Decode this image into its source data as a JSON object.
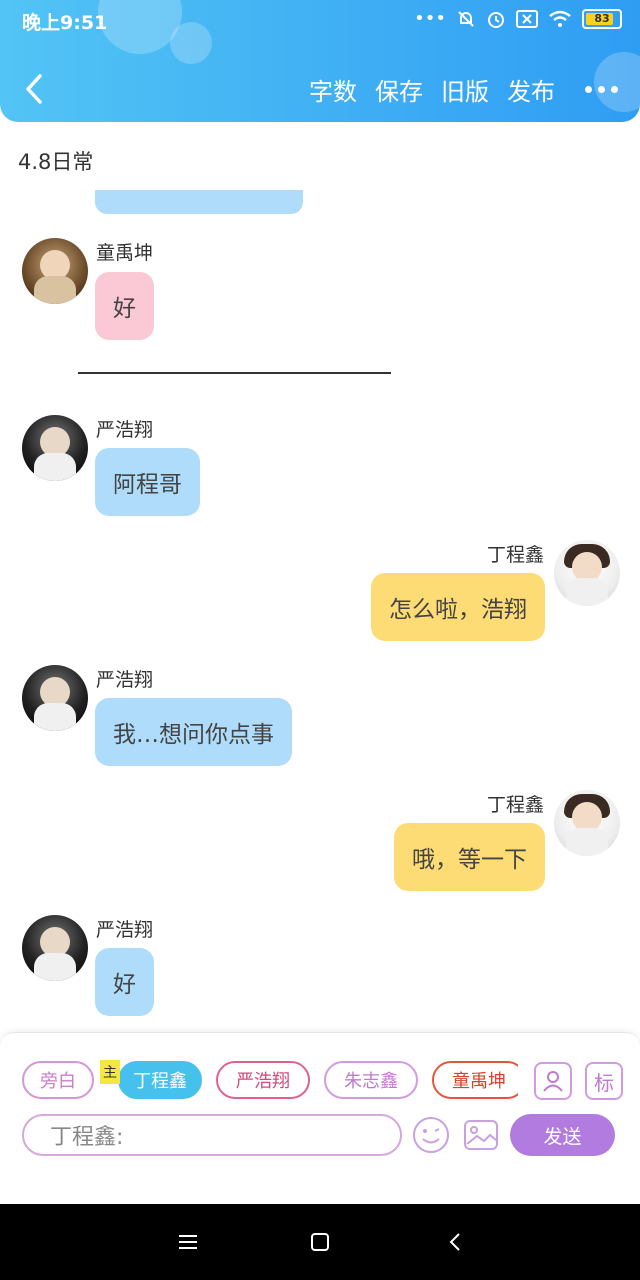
{
  "status_bar": {
    "time": "晚上9:51",
    "battery_level": 83,
    "battery_text": "83",
    "icons": [
      "more-dots-icon",
      "bell-muted-icon",
      "alarm-icon",
      "sim-blocked-icon",
      "wifi-icon",
      "battery-icon"
    ]
  },
  "header": {
    "actions": {
      "word_count": "字数",
      "save": "保存",
      "old_version": "旧版",
      "publish": "发布"
    },
    "accent_color": "#2f9df3"
  },
  "doc_title": "4.8日常",
  "messages": [
    {
      "id": "m1",
      "side": "left",
      "name": "童禹坤",
      "text": "好",
      "color": "pink"
    },
    {
      "id": "m2",
      "side": "left",
      "name": "严浩翔",
      "text": "阿程哥",
      "color": "blue"
    },
    {
      "id": "m3",
      "side": "right",
      "name": "丁程鑫",
      "text": "怎么啦，浩翔",
      "color": "yellow"
    },
    {
      "id": "m4",
      "side": "left",
      "name": "严浩翔",
      "text": "我…想问你点事",
      "color": "blue"
    },
    {
      "id": "m5",
      "side": "right",
      "name": "丁程鑫",
      "text": "哦，等一下",
      "color": "yellow"
    },
    {
      "id": "m6",
      "side": "left",
      "name": "严浩翔",
      "text": "好",
      "color": "blue"
    }
  ],
  "input_panel": {
    "roles": {
      "narration": "旁白",
      "main": "丁程鑫",
      "r1": "严浩翔",
      "r2": "朱志鑫",
      "r3": "童禹坤"
    },
    "main_tag": "主",
    "role_icon": "角",
    "mark_icon": "标",
    "input_placeholder": "丁程鑫:",
    "send_label": "发送"
  }
}
